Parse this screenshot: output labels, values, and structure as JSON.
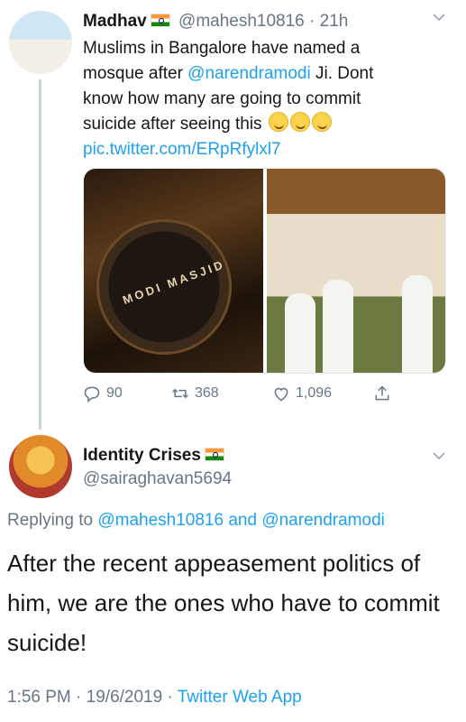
{
  "tweet1": {
    "name": "Madhav",
    "handle": "@mahesh10816",
    "dot": "·",
    "time": "21h",
    "text_parts": {
      "line1": "Muslims in Bangalore have named a",
      "line2_pre": "mosque after ",
      "mention": "@narendramodi",
      "line2_post": " Ji.  Dont",
      "line3": "know how many are going to commit",
      "line4": "suicide after seeing this "
    },
    "link": "pic.twitter.com/ERpRfylxl7",
    "media_sign_text": "MODI MASJID",
    "actions": {
      "replies": "90",
      "retweets": "368",
      "likes": "1,096"
    }
  },
  "tweet2": {
    "name": "Identity Crises",
    "handle": "@sairaghavan5694",
    "replying_label": "Replying to ",
    "replying_user1": "@mahesh10816",
    "replying_and": " and ",
    "replying_user2": "@narendramodi",
    "text": "After the recent appeasement politics of him, we are the ones who have to commit suicide!",
    "time": "1:56 PM",
    "dot": "·",
    "date": "19/6/2019",
    "source": "Twitter Web App"
  },
  "icons": [
    "reply-icon",
    "retweet-icon",
    "like-icon",
    "share-icon",
    "chevron-down-icon",
    "india-flag-icon"
  ],
  "colors": {
    "link": "#1da1f2",
    "muted": "#657786",
    "text": "#14171a"
  }
}
